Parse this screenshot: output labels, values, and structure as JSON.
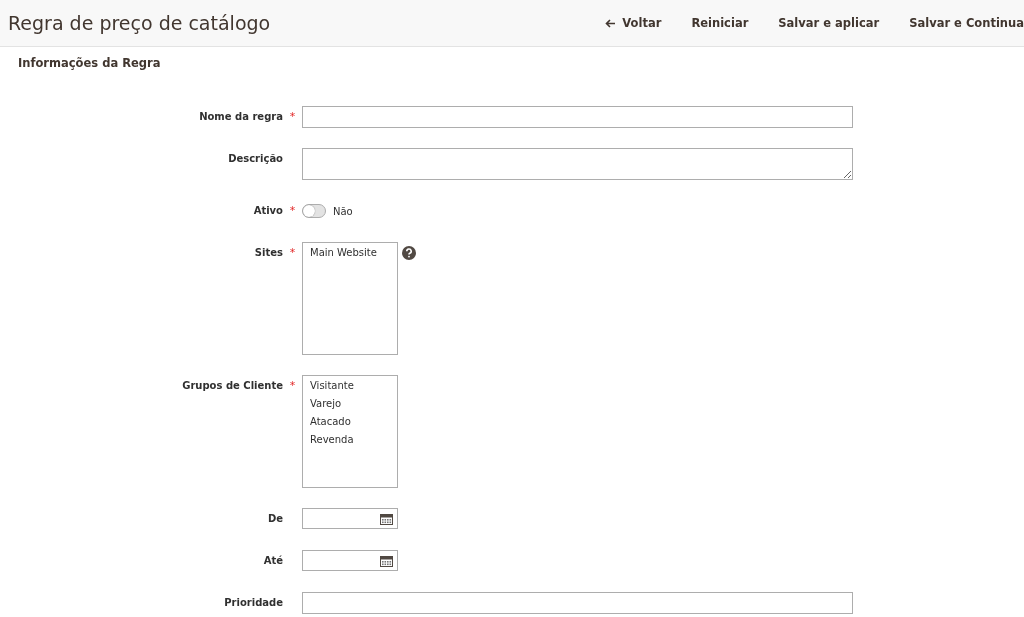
{
  "header": {
    "title": "Regra de preço de catálogo",
    "actions": [
      {
        "label": "Voltar",
        "kind": "back"
      },
      {
        "label": "Reiniciar",
        "kind": "plain"
      },
      {
        "label": "Salvar e aplicar",
        "kind": "plain"
      },
      {
        "label": "Salvar e Continua",
        "kind": "plain"
      }
    ]
  },
  "section": {
    "title": "Informações da Regra"
  },
  "fields": [
    {
      "kind": "text",
      "label": "Nome da regra",
      "required_mark": "*"
    },
    {
      "kind": "textarea",
      "label": "Descrição"
    },
    {
      "kind": "toggle",
      "label": "Ativo",
      "required_mark": "*",
      "on": false,
      "state_label": "Não"
    },
    {
      "kind": "multiselect",
      "label": "Sites",
      "required_mark": "*",
      "help": true,
      "options": [
        "Main Website"
      ]
    },
    {
      "kind": "multiselect",
      "label": "Grupos de Cliente",
      "required_mark": "*",
      "options": [
        "Visitante",
        "Varejo",
        "Atacado",
        "Revenda"
      ]
    },
    {
      "kind": "date",
      "label": "De"
    },
    {
      "kind": "date",
      "label": "Até"
    },
    {
      "kind": "text",
      "label": "Prioridade"
    }
  ]
}
